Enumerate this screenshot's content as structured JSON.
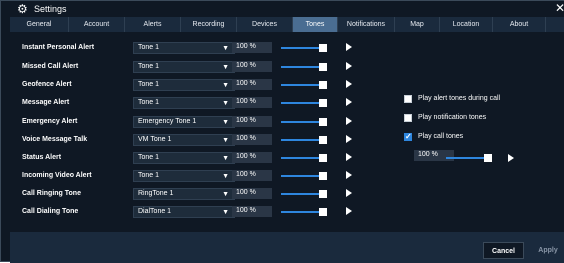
{
  "window": {
    "title": "Settings"
  },
  "tabs": [
    {
      "label": "General",
      "active": false
    },
    {
      "label": "Account",
      "active": false
    },
    {
      "label": "Alerts",
      "active": false
    },
    {
      "label": "Recording",
      "active": false
    },
    {
      "label": "Devices",
      "active": false
    },
    {
      "label": "Tones",
      "active": true
    },
    {
      "label": "Notifications",
      "active": false
    },
    {
      "label": "Map",
      "active": false
    },
    {
      "label": "Location",
      "active": false
    },
    {
      "label": "About",
      "active": false
    }
  ],
  "tones": [
    {
      "label": "Instant Personal Alert",
      "tone": "Tone 1",
      "volume": "100 %",
      "level": 1.0
    },
    {
      "label": "Missed Call Alert",
      "tone": "Tone 1",
      "volume": "100 %",
      "level": 1.0
    },
    {
      "label": "Geofence Alert",
      "tone": "Tone 1",
      "volume": "100 %",
      "level": 1.0
    },
    {
      "label": "Message Alert",
      "tone": "Tone 1",
      "volume": "100 %",
      "level": 1.0
    },
    {
      "label": "Emergency Alert",
      "tone": "Emergency Tone 1",
      "volume": "100 %",
      "level": 1.0
    },
    {
      "label": "Voice Message Talk",
      "tone": "VM Tone 1",
      "volume": "100 %",
      "level": 1.0
    },
    {
      "label": "Status Alert",
      "tone": "Tone 1",
      "volume": "100 %",
      "level": 1.0
    },
    {
      "label": "Incoming Video Alert",
      "tone": "Tone 1",
      "volume": "100 %",
      "level": 1.0
    },
    {
      "label": "Call Ringing Tone",
      "tone": "RingTone 1",
      "volume": "100 %",
      "level": 1.0
    },
    {
      "label": "Call Dialing Tone",
      "tone": "DialTone 1",
      "volume": "100 %",
      "level": 1.0
    }
  ],
  "options": [
    {
      "label": "Play alert tones during call",
      "checked": false
    },
    {
      "label": "Play notification tones",
      "checked": false
    },
    {
      "label": "Play call tones",
      "checked": true
    }
  ],
  "call_tones": {
    "volume": "100 %",
    "level": 1.0
  },
  "footer": {
    "cancel_label": "Cancel",
    "apply_label": "Apply"
  },
  "colors": {
    "accent": "#2e86de",
    "background": "#0f1824",
    "panel": "#1a2a3d",
    "active_tab": "#4a6d92"
  }
}
